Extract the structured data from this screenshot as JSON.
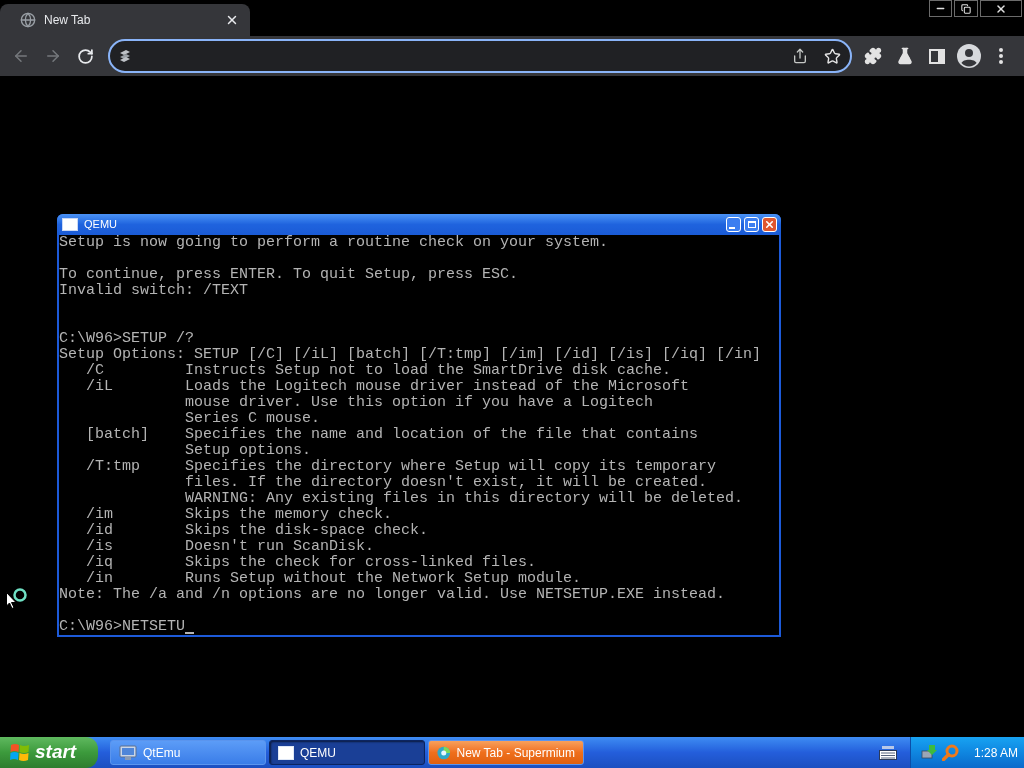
{
  "browser": {
    "tabs": [
      {
        "title": "New Tab",
        "selected": true
      }
    ],
    "navigation": {
      "back_disabled": true,
      "forward_disabled": true
    },
    "address_bar": {
      "focused": true
    }
  },
  "qemu_window": {
    "title": "QEMU",
    "active": true,
    "console": {
      "intro": "Setup is now going to perform a routine check on your system.",
      "prompt_lines": [
        "To continue, press ENTER. To quit Setup, press ESC.",
        "Invalid switch: /TEXT"
      ],
      "command": "C:\\W96>SETUP /?",
      "usage": "Setup Options: SETUP [/C] [/iL] [batch] [/T:tmp] [/im] [/id] [/is] [/iq] [/in]",
      "options": [
        {
          "switch": "/C",
          "description": [
            "Instructs Setup not to load the SmartDrive disk cache."
          ]
        },
        {
          "switch": "/iL",
          "description": [
            "Loads the Logitech mouse driver instead of the Microsoft",
            "mouse driver. Use this option if you have a Logitech",
            "Series C mouse."
          ]
        },
        {
          "switch": "[batch]",
          "description": [
            "Specifies the name and location of the file that contains",
            "Setup options."
          ]
        },
        {
          "switch": "/T:tmp",
          "description": [
            "Specifies the directory where Setup will copy its temporary",
            "files. If the directory doesn't exist, it will be created.",
            "WARNING: Any existing files in this directory will be deleted."
          ]
        },
        {
          "switch": "/im",
          "description": [
            "Skips the memory check."
          ]
        },
        {
          "switch": "/id",
          "description": [
            "Skips the disk-space check."
          ]
        },
        {
          "switch": "/is",
          "description": [
            "Doesn't run ScanDisk."
          ]
        },
        {
          "switch": "/iq",
          "description": [
            "Skips the check for cross-linked files."
          ]
        },
        {
          "switch": "/in",
          "description": [
            "Runs Setup without the Network Setup module."
          ]
        }
      ],
      "note": "Note: The /a and /n options are no longer valid. Use NETSETUP.EXE instead.",
      "input": "C:\\W96>NETSETU",
      "cursor": true
    }
  },
  "taskbar": {
    "start": "start",
    "tasks": [
      {
        "kind": "qtemu",
        "label": "QtEmu",
        "selected": false,
        "flashing": false
      },
      {
        "kind": "qemu",
        "label": "QEMU",
        "selected": true,
        "flashing": false
      },
      {
        "kind": "browser",
        "label": "New Tab - Supermium",
        "selected": false,
        "flashing": true
      }
    ],
    "clock": "1:28 AM"
  }
}
